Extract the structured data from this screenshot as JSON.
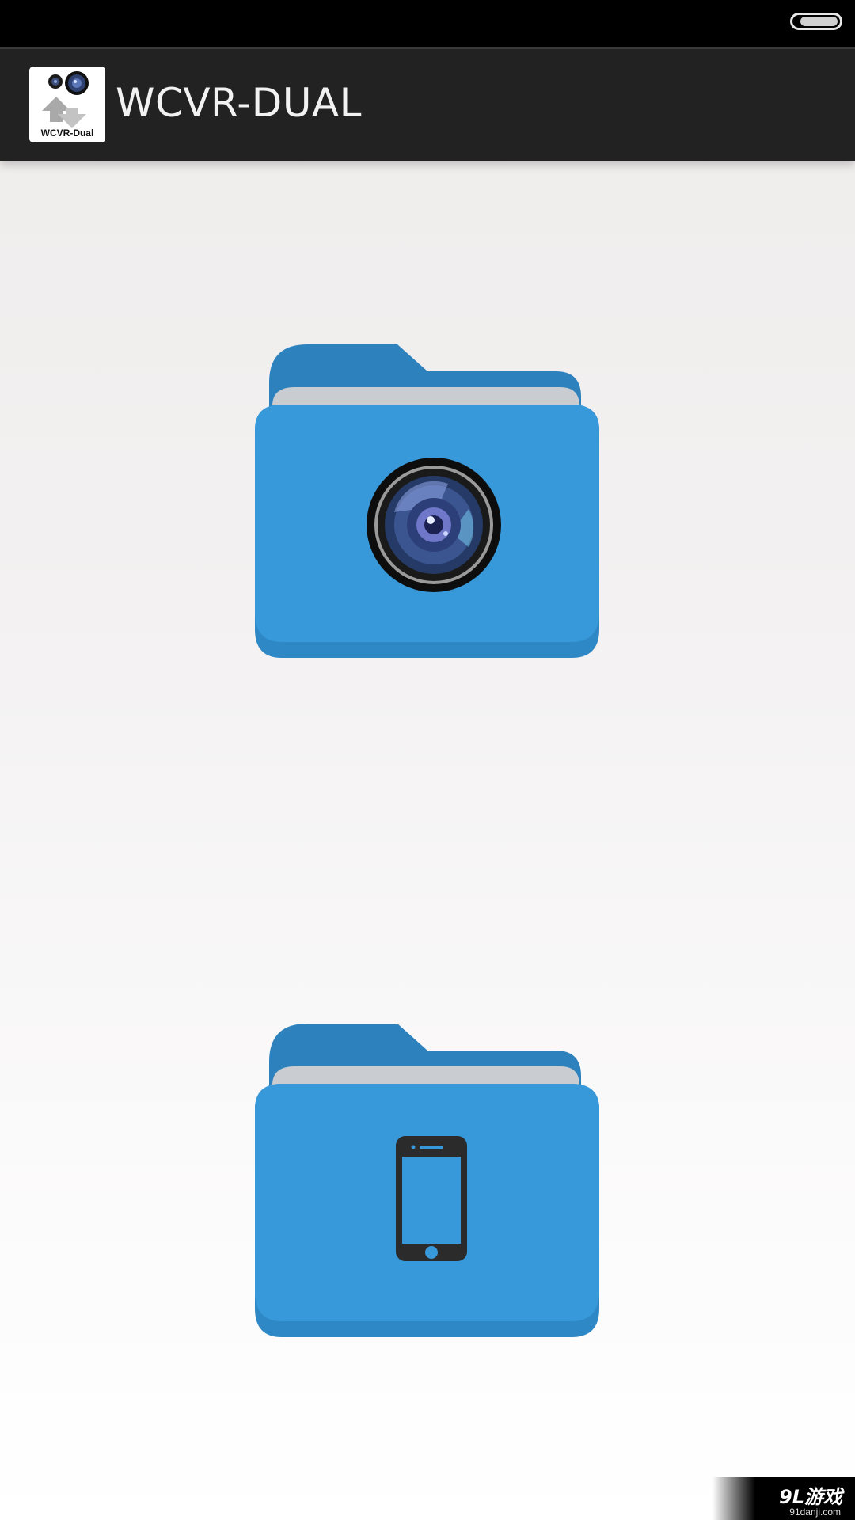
{
  "app": {
    "title": "WCVR-DUAL",
    "icon_label": "WCVR-Dual"
  },
  "folders": [
    {
      "name": "camera-folder",
      "icon": "camera-lens-icon"
    },
    {
      "name": "phone-folder",
      "icon": "smartphone-icon"
    }
  ],
  "watermark": {
    "logo": "9L游戏",
    "url": "91danji.com"
  },
  "colors": {
    "action_bar": "#222222",
    "folder_front": "#3899da",
    "folder_back": "#2d82be",
    "folder_paper": "#c9ccd0",
    "phone_icon": "#2b2b2b"
  }
}
